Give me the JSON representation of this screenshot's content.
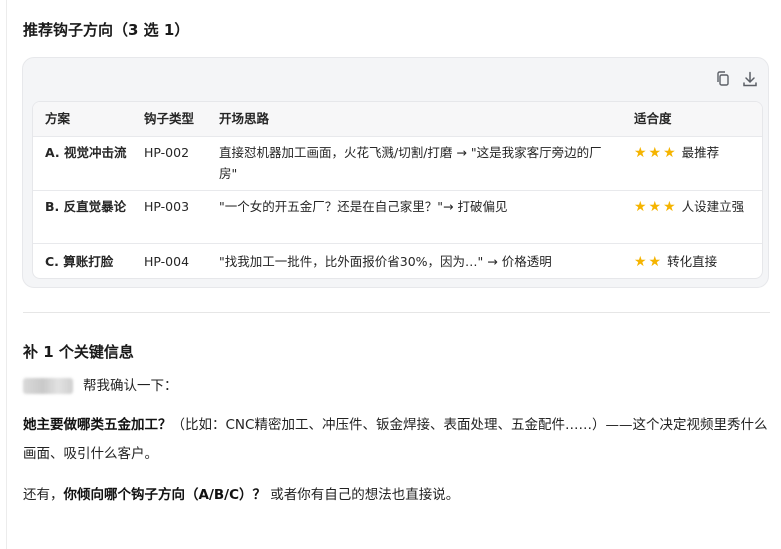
{
  "section1": {
    "title": "推荐钩子方向（3 选 1）"
  },
  "card": {
    "toolbar": {
      "copy_icon": "copy-icon",
      "download_icon": "download-icon"
    },
    "columns": [
      "方案",
      "钩子类型",
      "开场思路",
      "适合度"
    ],
    "rows": [
      {
        "plan": "A. 视觉冲击流",
        "hook": "HP-002",
        "opening": "直接怼机器加工画面，火花飞溅/切割/打磨 → \"这是我家客厅旁边的厂房\"",
        "stars": "★★★",
        "fit": "最推荐"
      },
      {
        "plan": "B. 反直觉暴论",
        "hook": "HP-003",
        "opening": "\"一个女的开五金厂？还是在自己家里？\"→ 打破偏见",
        "stars": "★★★",
        "fit": "人设建立强"
      },
      {
        "plan": "C. 算账打脸",
        "hook": "HP-004",
        "opening": "\"找我加工一批件，比外面报价省30%，因为…\" → 价格透明",
        "stars": "★★",
        "fit": "转化直接"
      }
    ]
  },
  "section2": {
    "title": "补 1 个关键信息",
    "confirm": "帮我确认一下：",
    "q1_bold": "她主要做哪类五金加工？",
    "q1_rest": "（比如：CNC精密加工、冲压件、钣金焊接、表面处理、五金配件……）——这个决定视频里秀什么画面、吸引什么客户。",
    "q2_pre": "还有，",
    "q2_bold": "你倾向哪个钩子方向（A/B/C）？",
    "q2_rest": " 或者你有自己的想法也直接说。"
  },
  "colors": {
    "star": "#f5b400",
    "card_bg": "#f4f5f7",
    "border": "#e6e7ea"
  }
}
